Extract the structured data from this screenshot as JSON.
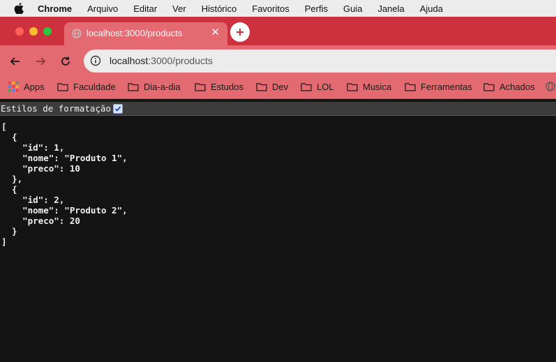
{
  "menubar": {
    "app_name": "Chrome",
    "items": [
      "Arquivo",
      "Editar",
      "Ver",
      "Histórico",
      "Favoritos",
      "Perfis",
      "Guia",
      "Janela",
      "Ajuda"
    ]
  },
  "tab": {
    "title": "localhost:3000/products",
    "close_glyph": "✕",
    "favicon_icon": "globe-icon"
  },
  "newtab": {
    "glyph": "+"
  },
  "omnibox": {
    "host": "localhost",
    "path": ":3000/products",
    "info_icon": "info-icon"
  },
  "bookmarks": {
    "apps_label": "Apps",
    "folders": [
      "Faculdade",
      "Dia-a-dia",
      "Estudos",
      "Dev",
      "LOL",
      "Musica",
      "Ferramentas",
      "Achados"
    ]
  },
  "pretty_print": {
    "label": "Estilos de formatação",
    "checked": true
  },
  "json_lines": [
    "[",
    "  {",
    "    \"id\": 1,",
    "    \"nome\": \"Produto 1\",",
    "    \"preco\": 10",
    "  },",
    "  {",
    "    \"id\": 2,",
    "    \"nome\": \"Produto 2\",",
    "    \"preco\": 20",
    "  }",
    "]"
  ],
  "colors": {
    "tabstrip": "#cd313d",
    "toolbar": "#e26a70",
    "page_bg": "#141414"
  }
}
